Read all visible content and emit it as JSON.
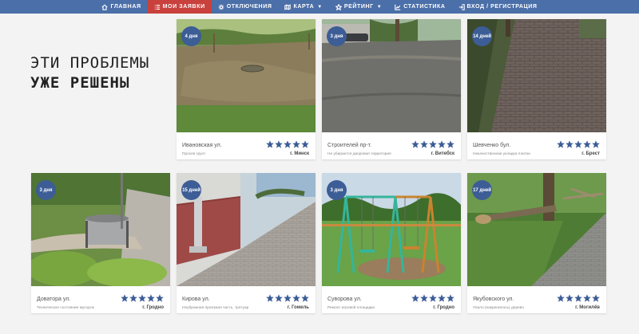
{
  "nav": {
    "items": [
      {
        "label": "Главная",
        "icon": "home-icon",
        "active": false,
        "dropdown": false
      },
      {
        "label": "Мои заявки",
        "icon": "list-icon",
        "active": true,
        "dropdown": false
      },
      {
        "label": "Отключения",
        "icon": "gear-icon",
        "active": false,
        "dropdown": false
      },
      {
        "label": "Карта",
        "icon": "map-icon",
        "active": false,
        "dropdown": true
      },
      {
        "label": "Рейтинг",
        "icon": "star-icon",
        "active": false,
        "dropdown": true
      },
      {
        "label": "Статистика",
        "icon": "chart-icon",
        "active": false,
        "dropdown": false
      },
      {
        "label": "Вход / Регистрация",
        "icon": "login-icon",
        "active": false,
        "dropdown": false
      }
    ]
  },
  "headline": {
    "line1": "ЭТИ ПРОБЛЕМЫ",
    "line2": "УЖЕ РЕШЕНЫ"
  },
  "cards": [
    {
      "days": "4 дня",
      "street": "Ивановская ул.",
      "desc": "Просев грунт",
      "city": "г. Минск",
      "rating": 5
    },
    {
      "days": "3 дня",
      "street": "Строителей пр-т.",
      "desc": "Не убирается дворовая территория",
      "city": "г. Витебск",
      "rating": 5
    },
    {
      "days": "14 дней",
      "street": "Шевченко бул.",
      "desc": "Некачественная укладка плитки",
      "city": "г. Брест",
      "rating": 5
    },
    {
      "days": "3 дня",
      "street": "Доватора ул.",
      "desc": "Техническое состояние мусорок",
      "city": "г. Гродно",
      "rating": 5
    },
    {
      "days": "15 дней",
      "street": "Кирова ул.",
      "desc": "Неубранная проезжая часть, тротуар",
      "city": "г. Гомель",
      "rating": 5
    },
    {
      "days": "3 дня",
      "street": "Суворова ул.",
      "desc": "Ремонт игровой площадки",
      "city": "г. Гродно",
      "rating": 5
    },
    {
      "days": "17 дней",
      "street": "Якубовского ул.",
      "desc": "Упало (накренилось) дерево",
      "city": "г. Могилёв",
      "rating": 5
    }
  ],
  "colors": {
    "nav": "#4b6fa8",
    "active": "#c9413c",
    "accent": "#3c5d96"
  }
}
